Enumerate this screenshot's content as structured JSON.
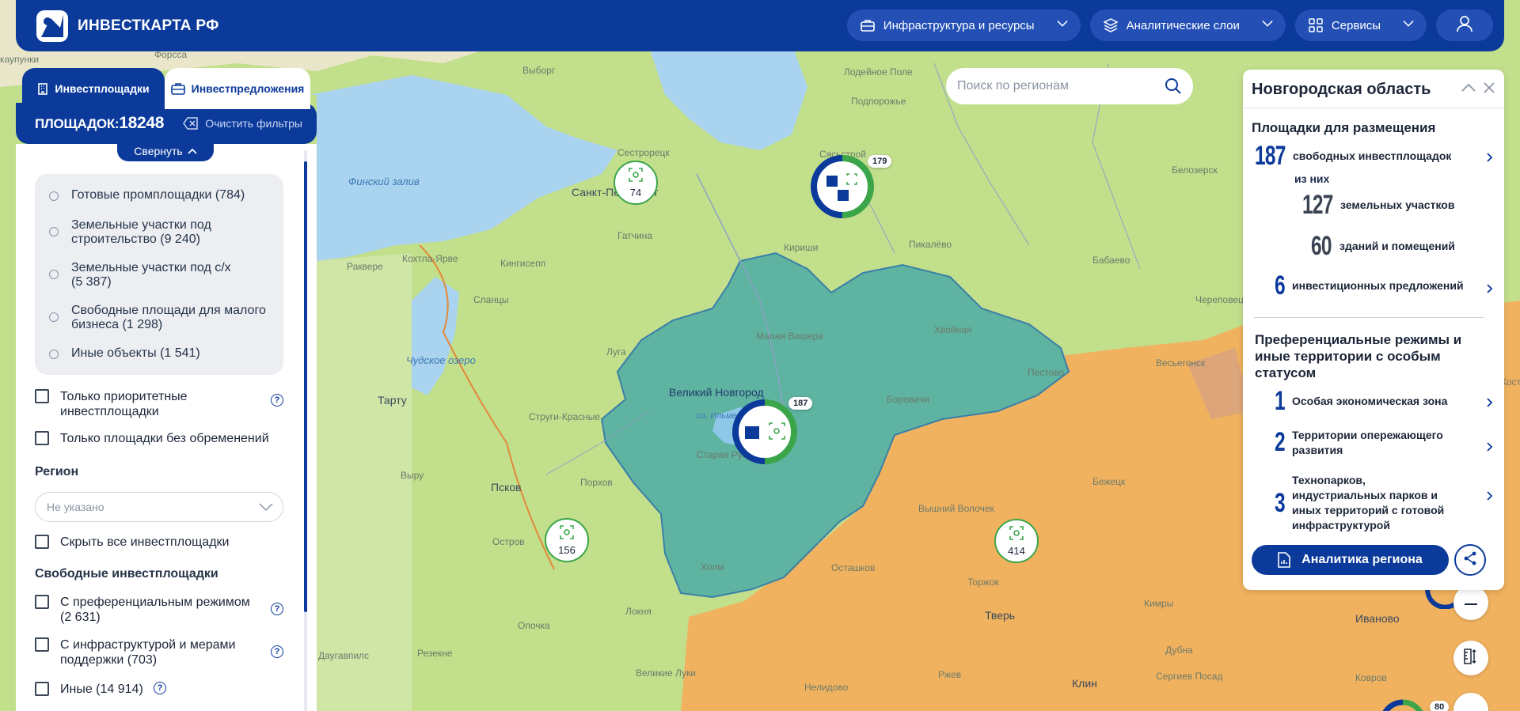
{
  "header": {
    "logo_text": "ИНВЕСТКАРТА РФ",
    "nav": [
      {
        "label": "Инфраструктура и ресурсы",
        "icon": "briefcase-icon"
      },
      {
        "label": "Аналитические слои",
        "icon": "layers-icon"
      },
      {
        "label": "Сервисы",
        "icon": "grid-icon"
      }
    ],
    "user_icon": "user-icon"
  },
  "left": {
    "tabs": [
      {
        "label": "Инвестплощадки",
        "icon": "building-icon",
        "active": true
      },
      {
        "label": "Инвестпредложения",
        "icon": "briefcase-icon",
        "active": false
      }
    ],
    "count_prefix": "ПЛОЩАДОК:",
    "count_value": "18248",
    "clear_filters": "Очистить фильтры",
    "collapse": "Свернуть",
    "types": [
      "Готовые промплощадки (784)",
      "Земельные участки под строительство (9 240)",
      "Земельные участки под с/х (5 387)",
      "Свободные площади для малого бизнеса (1 298)",
      "Иные объекты (1 541)"
    ],
    "checkbox_priority": "Только приоритетные инвестплощадки",
    "checkbox_no_encumbrance": "Только площадки без обременений",
    "region_title": "Регион",
    "region_placeholder": "Не указано",
    "checkbox_hide_all": "Скрыть все инвестплощадки",
    "free_title": "Свободные инвестплощадки",
    "checkbox_pref": "С преференциальным режимом (2 631)",
    "checkbox_infra": "С инфраструктурой и мерами поддержки (703)",
    "checkbox_other": "Иные (14 914)",
    "help_symbol": "?"
  },
  "search": {
    "placeholder": "Поиск по регионам"
  },
  "right": {
    "title": "Новгородская область",
    "placement_title": "Площадки для размещения",
    "free_sites_num": "187",
    "free_sites_label": "свободных инвестплощадок",
    "of_them": "из них",
    "land_num": "127",
    "land_label": "земельных участков",
    "buildings_num": "60",
    "buildings_label": "зданий и помещений",
    "offers_num": "6",
    "offers_label": "инвестиционных предложений",
    "pref_title": "Преференциальные режимы и иные территории с особым статусом",
    "sez_num": "1",
    "sez_label": "Особая экономическая зона",
    "tor_num": "2",
    "tor_label": "Территории опережающего развития",
    "tech_num": "3",
    "tech_label": "Технопарков, индустриальных парков и иных территорий с готовой инфраструктурой",
    "analytics": "Аналитика региона"
  },
  "map": {
    "labels": {
      "forssa": "Форсса",
      "kaupunki": "каупунки",
      "vyborg": "Выборг",
      "finnish_gulf": "Финский залив",
      "spb": "Санкт-Петербург",
      "sestroretsk": "Сестрорецк",
      "gatchina": "Гатчина",
      "sysstroy": "Сясьстрой",
      "kirishi": "Кириши",
      "pikalevo": "Пикалёво",
      "babaevo": "Бабаево",
      "cherepovets": "Череповец",
      "belozersk": "Белозерск",
      "rakvere": "Раквере",
      "kokhtla": "Кохтла-Ярве",
      "kingisepp": "Кингисепп",
      "slantsy": "Сланцы",
      "luga": "Луга",
      "chudskoe": "Чудское озеро",
      "tartu": "Тарту",
      "malaya_vishera": "Малая Вишера",
      "khvoinaya": "Хвойная",
      "pestovo": "Пестово",
      "veliky_novgorod": "Великий Новгород",
      "lake_ilmen": "оз. Ильмень",
      "staraya_russa": "Старая Русса",
      "borovichi": "Боровичи",
      "vesyegonsk": "Весьегонск",
      "struga": "Струги-Красные",
      "porkhov": "Порхов",
      "pskov": "Псков",
      "vyru": "Выру",
      "ostrov": "Остров",
      "kholm": "Холм",
      "bezhetsk": "Бежецк",
      "vyshny": "Вышний Волочек",
      "torzhok": "Торжок",
      "ostashkov": "Осташков",
      "kimry": "Кимры",
      "tver": "Тверь",
      "loknya": "Локня",
      "opochka": "Опочка",
      "rezekne": "Резекне",
      "velikie_luki": "Великие Луки",
      "nelidovo": "Нелидово",
      "rzhev": "Ржев",
      "klin": "Клин",
      "sergiev": "Сергиев Посад",
      "ivanovo": "Иваново",
      "kovrov": "Ковров",
      "dubna": "Дубна",
      "podporozhye": "Подпорожье",
      "lodeinoe": "Лодейное Поле",
      "daugavpils": "Даугавпилс",
      "kost": "Кост"
    },
    "markers": {
      "spb_count": "74",
      "leningrad_badge": "179",
      "novgorod_badge": "187",
      "pskov_count": "156",
      "tver_count": "414",
      "bottom_badge": "80"
    },
    "colors": {
      "green_region": "#c5e08a",
      "novgorod_fill": "#5fb3a1",
      "orange_region": "#f1b25f",
      "water": "#a9d3ee",
      "accent": "#0b3a9b",
      "green_ring": "#3ca54a"
    }
  }
}
